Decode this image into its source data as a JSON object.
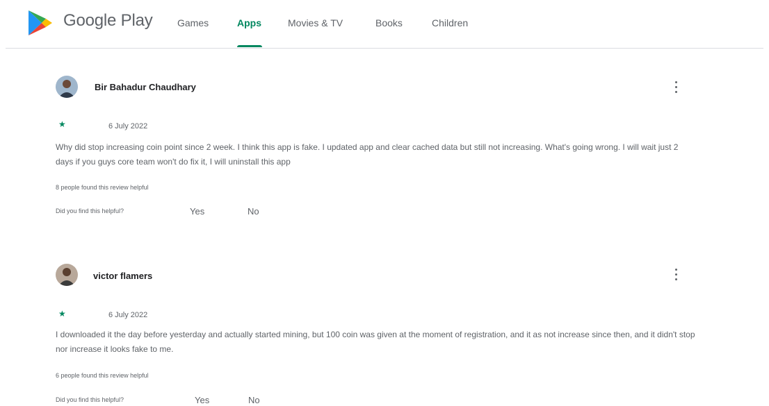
{
  "header": {
    "brand": "Google Play",
    "tabs": [
      {
        "label": "Games",
        "active": false
      },
      {
        "label": "Apps",
        "active": true
      },
      {
        "label": "Movies & TV",
        "active": false
      },
      {
        "label": "Books",
        "active": false
      },
      {
        "label": "Children",
        "active": false
      }
    ]
  },
  "colors": {
    "accent": "#01875f",
    "text_secondary": "#5f6368",
    "divider": "#dadce0"
  },
  "reviews": [
    {
      "name": "Bir Bahadur Chaudhary",
      "rating": 1,
      "star_glyph": "★",
      "date": "6 July 2022",
      "text": "Why did stop increasing coin point since 2 week. I think this app is fake. I updated app and clear cached data but still not increasing. What's going wrong. I will wait just 2 days if you guys core team won't do fix it, I will uninstall this app",
      "helpful_count": "8 people found this review helpful",
      "helpful_question": "Did you find this helpful?",
      "yes_label": "Yes",
      "no_label": "No"
    },
    {
      "name": "victor flamers",
      "rating": 1,
      "star_glyph": "★",
      "date": "6 July 2022",
      "text": "I downloaded it the day before yesterday and actually started mining, but 100 coin was given at the moment of registration, and it as not increase since then, and it didn't stop nor increase it looks fake to me.",
      "helpful_count": "6 people found this review helpful",
      "helpful_question": "Did you find this helpful?",
      "yes_label": "Yes",
      "no_label": "No"
    }
  ]
}
